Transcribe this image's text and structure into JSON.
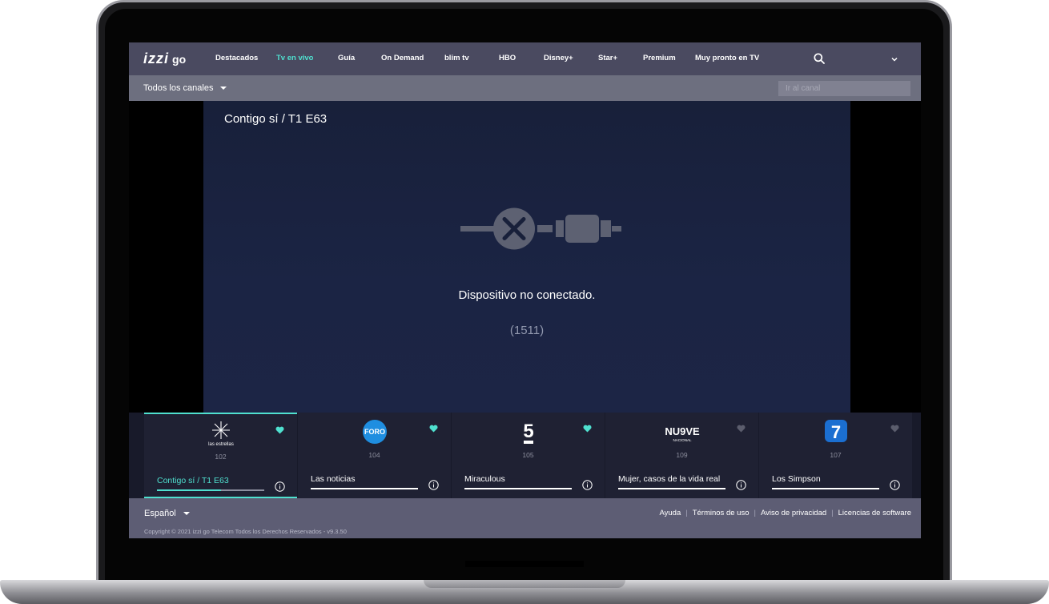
{
  "nav": {
    "logo_text": "izzi",
    "logo_suffix": "go",
    "items": [
      {
        "label": "Destacados",
        "active": false
      },
      {
        "label": "Tv en vivo",
        "active": true
      },
      {
        "label": "Guía",
        "active": false
      },
      {
        "label": "On Demand",
        "active": false
      },
      {
        "label": "blim tv",
        "active": false
      },
      {
        "label": "HBO",
        "active": false
      },
      {
        "label": "Disney+",
        "active": false
      },
      {
        "label": "Star+",
        "active": false
      },
      {
        "label": "Premium",
        "active": false
      },
      {
        "label": "Muy pronto en TV",
        "active": false
      }
    ],
    "search_icon": "search-icon",
    "menu_icon": "chevron-down-icon"
  },
  "subbar": {
    "channels_filter": "Todos los canales",
    "channel_input_placeholder": "Ir al canal"
  },
  "player": {
    "title": "Contigo sí / T1 E63",
    "message": "Dispositivo no conectado.",
    "error_code": "(1511)",
    "icon": "disconnected-plug-icon"
  },
  "channels": [
    {
      "logo_text": "las estrellas",
      "number": "102",
      "program": "Contigo sí / T1 E63",
      "progress": 0.6,
      "favorite": true,
      "active": true
    },
    {
      "logo_text": "FORO",
      "number": "104",
      "program": "Las noticias",
      "progress": 0.98,
      "favorite": true,
      "active": false
    },
    {
      "logo_text": "5",
      "number": "105",
      "program": "Miraculous",
      "progress": 0.98,
      "favorite": true,
      "active": false
    },
    {
      "logo_text": "NU9VE",
      "number": "109",
      "program": "Mujer, casos de la vida real",
      "progress": 0.98,
      "favorite": false,
      "active": false
    },
    {
      "logo_text": "7",
      "number": "107",
      "program": "Los Simpson",
      "progress": 0.98,
      "favorite": false,
      "active": false
    }
  ],
  "footer": {
    "language": "Español",
    "links": [
      "Ayuda",
      "Términos de uso",
      "Aviso de privacidad",
      "Licencias de software"
    ],
    "copyright": "Copyright © 2021 izzi go Telecom Todos los Derechos Reservados - v9.3.50"
  },
  "colors": {
    "accent": "#4fe0cf",
    "nav_bg": "#4a4a60",
    "subbar_bg": "#6d6f7f",
    "player_bg": "#1b2444",
    "footer_bg": "#5d5d74",
    "heart_on": "#4fe0cf",
    "heart_off": "#5b5d6d"
  }
}
